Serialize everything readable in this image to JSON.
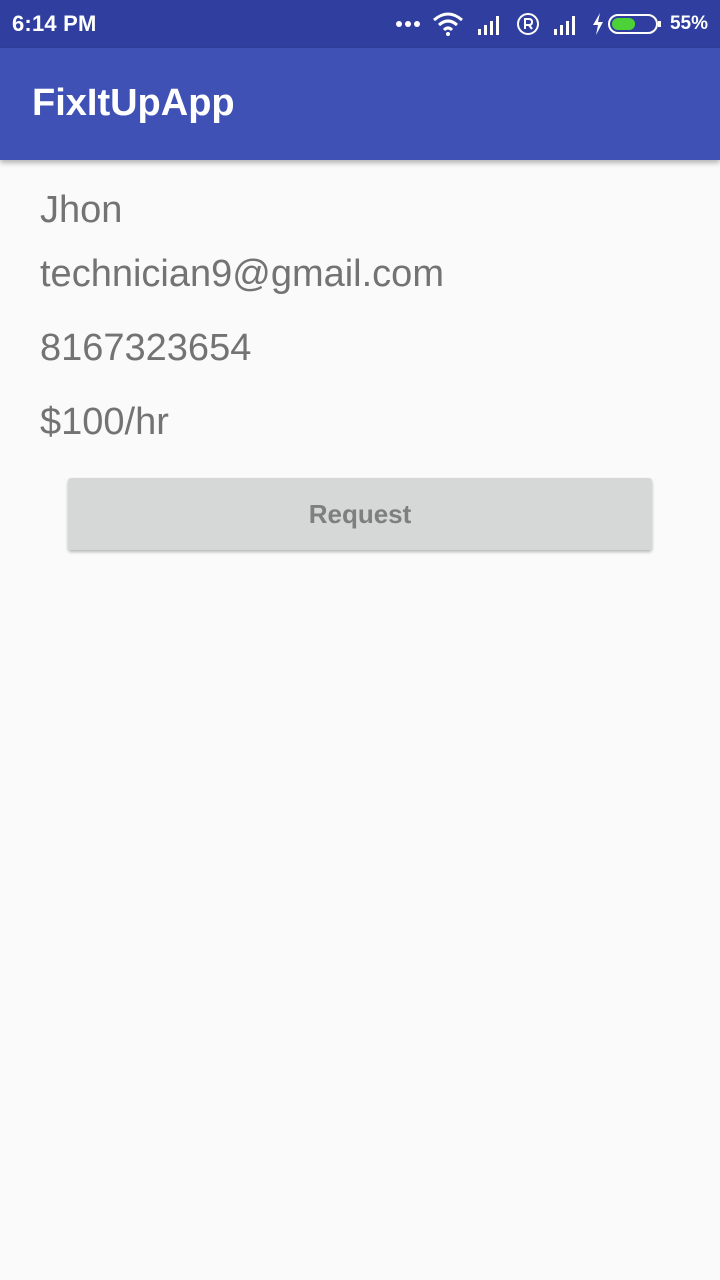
{
  "status_bar": {
    "time": "6:14 PM",
    "battery_percent": "55%",
    "battery_level": 0.55,
    "icons": [
      "more-dots-icon",
      "wifi-icon",
      "signal-icon",
      "registered-icon",
      "signal-icon",
      "charging-icon",
      "battery-icon"
    ],
    "background_color": "#303f9f"
  },
  "app_bar": {
    "title": "FixItUpApp",
    "background_color": "#3f51b5"
  },
  "profile": {
    "name": "Jhon",
    "email": "technician9@gmail.com",
    "phone": "8167323654",
    "rate": "$100/hr"
  },
  "actions": {
    "request_label": "Request"
  }
}
